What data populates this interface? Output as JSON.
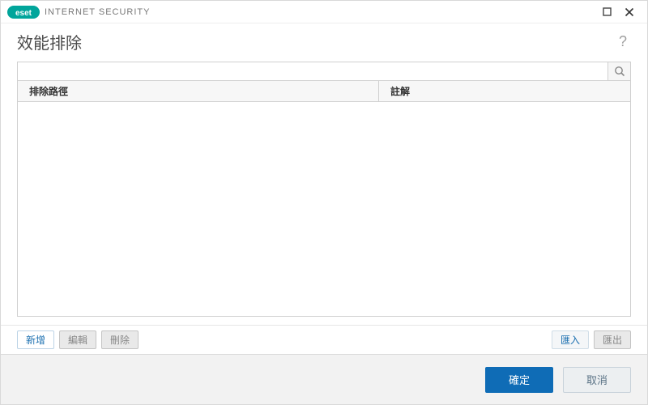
{
  "titlebar": {
    "brand_text": "eset",
    "product_name": "INTERNET SECURITY"
  },
  "header": {
    "title": "效能排除",
    "help_symbol": "?"
  },
  "search": {
    "placeholder": ""
  },
  "table": {
    "columns": {
      "path": "排除路徑",
      "comment": "註解"
    },
    "rows": []
  },
  "toolbar": {
    "add": "新增",
    "edit": "編輯",
    "delete": "刪除",
    "import": "匯入",
    "export": "匯出"
  },
  "footer": {
    "ok": "確定",
    "cancel": "取消"
  }
}
